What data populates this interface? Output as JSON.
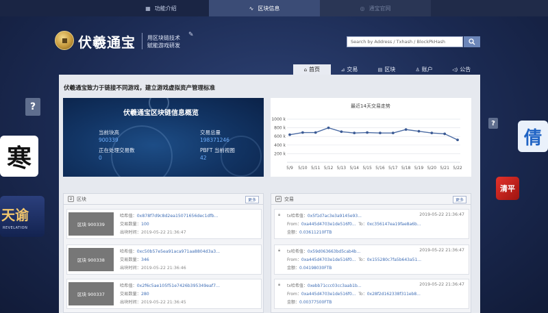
{
  "topnav": {
    "tabs": [
      {
        "label": "功能介绍",
        "icon": "grid-icon"
      },
      {
        "label": "区块信息",
        "icon": "activity-icon",
        "active": true
      },
      {
        "label": "通宝官网",
        "icon": "globe-icon"
      }
    ]
  },
  "header": {
    "brand": "伏羲通宝",
    "sub_line1": "用区块链技术",
    "sub_line2": "赋能游戏研发",
    "search_placeholder": "Search by Address / Txhash / BlockPkHash"
  },
  "mainnav": {
    "items": [
      {
        "label": "首页",
        "icon": "home-icon",
        "active": true
      },
      {
        "label": "交易",
        "icon": "chart-icon"
      },
      {
        "label": "区块",
        "icon": "block-icon"
      },
      {
        "label": "账户",
        "icon": "user-icon"
      },
      {
        "label": "公告",
        "icon": "speaker-icon"
      }
    ]
  },
  "tagline": "伏羲通宝致力于链接不同游戏，建立游戏虚拟资产管理标准",
  "overview": {
    "title": "伏羲通宝区块链信息概览",
    "height_label": "当前块高",
    "height_value": "900339",
    "tx_total_label": "交易总量",
    "tx_total_value": "198371246",
    "processing_label": "正在处理交易数",
    "processing_value": "0",
    "pbft_label": "PBFT 当前视图",
    "pbft_value": "42"
  },
  "chart_data": {
    "type": "line",
    "title": "最近14天交易走势",
    "categories": [
      "5/9",
      "5/10",
      "5/11",
      "5/12",
      "5/13",
      "5/14",
      "5/15",
      "5/16",
      "5/17",
      "5/18",
      "5/19",
      "5/20",
      "5/21",
      "5/22"
    ],
    "values": [
      640,
      690,
      690,
      800,
      710,
      680,
      690,
      680,
      680,
      760,
      720,
      680,
      660,
      520
    ],
    "ylim": [
      0,
      1000
    ],
    "yticks": [
      "1000 k",
      "800 k",
      "600 k",
      "400 k",
      "200 k"
    ],
    "grid": true,
    "colors": {
      "line": "#4a6aa3",
      "point": "#3b5a94"
    }
  },
  "blocks": {
    "title": "区块",
    "more_label": "更多",
    "hash_label": "哈希值：",
    "tx_count_label": "交易数量：",
    "time_label": "出块时间：",
    "items": [
      {
        "name": "区块 900339",
        "hash": "0x878f7d9c8d2ea15071656dec1dfb...",
        "tx_count": "100",
        "time": "2019-05-22 21:36:47"
      },
      {
        "name": "区块 900338",
        "hash": "0xc50b57e5ea91aca971aa8804d3a3...",
        "tx_count": "346",
        "time": "2019-05-22 21:36:46"
      },
      {
        "name": "区块 900337",
        "hash": "0x2f6c5ae105f51e7426b395349eaf7...",
        "tx_count": "280",
        "time": "2019-05-22 21:36:45"
      }
    ]
  },
  "transactions": {
    "title": "交易",
    "more_label": "更多",
    "hash_label": "tx哈希值：",
    "from_label": "From：",
    "to_label": "To：",
    "amount_label": "金额：",
    "items": [
      {
        "hash": "0x5f1d7ac3e3a9145e93...",
        "time": "2019-05-22 21:36:47",
        "from": "0xa445d4703e1de516f0...",
        "to": "0xc356147ea19fae8a6b...",
        "amount": "0.03611210FTB"
      },
      {
        "hash": "0x59d063663bd5cab4b...",
        "time": "2019-05-22 21:36:47",
        "from": "0xa445d4703e1de516f0...",
        "to": "0x155280c7fa5b643a51...",
        "amount": "0.04198030FTB"
      },
      {
        "hash": "0xebb71ccc03cc3aab1b...",
        "time": "2019-05-22 21:36:47",
        "from": "0xa445d4703e1de516f0...",
        "to": "0x28f2d162338f311eb8...",
        "amount": "0.00377500FTB"
      }
    ]
  },
  "side": {
    "question": "?",
    "game_han": "寒",
    "game_tianyu": "天谕",
    "game_tianyu_sub": "REVELATION",
    "game_qing": "倩",
    "game_red": "清平"
  }
}
